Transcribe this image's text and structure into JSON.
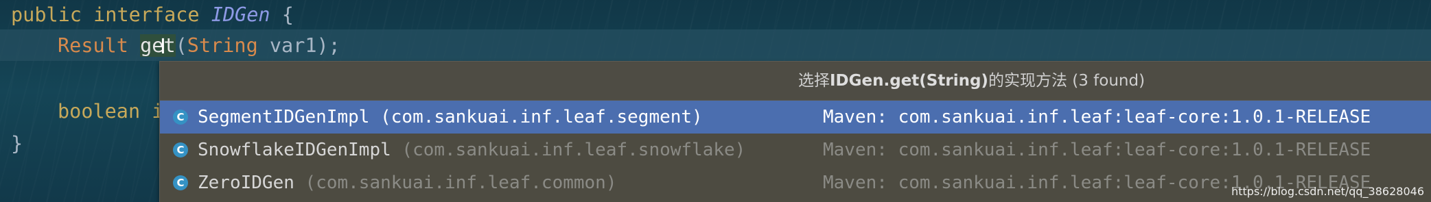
{
  "code": {
    "line1": {
      "kw_public": "public",
      "kw_interface": "interface",
      "name": "IDGen",
      "brace": " {"
    },
    "line2": {
      "type": "Result",
      "method": "get",
      "open": "(",
      "param_type": "String",
      "param": " var1);"
    },
    "line3": {
      "kw": "boolean",
      "partial": " i"
    },
    "line4": {
      "brace": "}"
    }
  },
  "popup": {
    "title_prefix": "选择",
    "title_bold": "IDGen.get(String)",
    "title_suffix": "的实现方法 (3 found)",
    "items": [
      {
        "icon": "C",
        "class_name": "SegmentIDGenImpl",
        "package": " (com.sankuai.inf.leaf.segment)",
        "library": "Maven: com.sankuai.inf.leaf:leaf-core:1.0.1-RELEASE",
        "selected": true
      },
      {
        "icon": "C",
        "class_name": "SnowflakeIDGenImpl",
        "package": " (com.sankuai.inf.leaf.snowflake)",
        "library": "Maven: com.sankuai.inf.leaf:leaf-core:1.0.1-RELEASE",
        "selected": false
      },
      {
        "icon": "C",
        "class_name": "ZeroIDGen",
        "package": " (com.sankuai.inf.leaf.common)",
        "library": "Maven: com.sankuai.inf.leaf:leaf-core:1.0.1-RELEASE",
        "selected": false
      }
    ]
  },
  "watermark": "https://blog.csdn.net/qq_38628046",
  "colors": {
    "editor_bg": "#123a4b",
    "popup_bg": "#4d4b41",
    "selection": "#4b6eaf",
    "class_icon": "#3592c4"
  },
  "icons": {
    "class": "class-icon",
    "cursor": "text-cursor-icon"
  }
}
